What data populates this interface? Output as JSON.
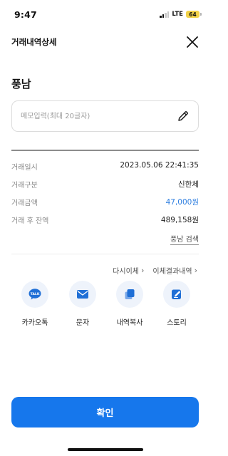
{
  "status_bar": {
    "time": "9:47",
    "network": "LTE",
    "battery": "64"
  },
  "header": {
    "title": "거래내역상세",
    "close_icon": "close-icon"
  },
  "counterparty": "풍남",
  "memo": {
    "placeholder": "메모입력(최대 20글자)",
    "value": "",
    "edit_icon": "pencil-icon"
  },
  "details": [
    {
      "label": "거래일시",
      "value": "2023.05.06 22:41:35"
    },
    {
      "label": "거래구분",
      "value": "신한체"
    },
    {
      "label": "거래금액",
      "value": "47,000원"
    },
    {
      "label": "거래 후 잔액",
      "value": "489,158원"
    }
  ],
  "search_link": "풍남 검색",
  "quick_links": [
    {
      "label": "다시이체",
      "icon": "chevron-right-icon"
    },
    {
      "label": "이체결과내역",
      "icon": "chevron-right-icon"
    }
  ],
  "share": [
    {
      "label": "카카오톡",
      "icon": "kakaotalk-icon"
    },
    {
      "label": "문자",
      "icon": "envelope-icon"
    },
    {
      "label": "내역복사",
      "icon": "copy-icon"
    },
    {
      "label": "스토리",
      "icon": "story-edit-icon"
    }
  ],
  "confirm_label": "확인",
  "colors": {
    "primary": "#1677ec",
    "amount": "#2f7fe0",
    "icon_bg": "#eef3fb"
  }
}
